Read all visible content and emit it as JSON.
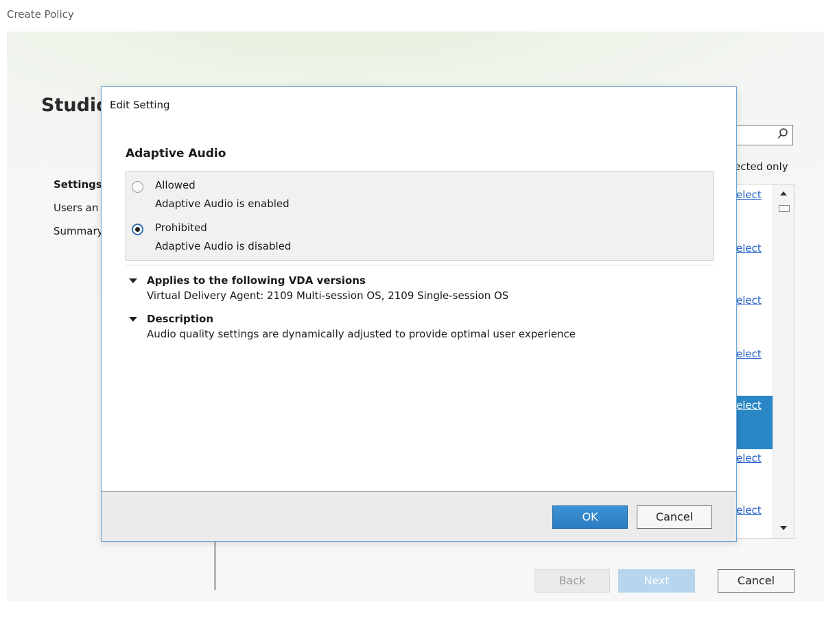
{
  "window": {
    "title": "Create Policy"
  },
  "wizard": {
    "brand": "Studio",
    "steps": [
      {
        "label": "Settings",
        "active": true
      },
      {
        "label": "Users an",
        "active": false
      },
      {
        "label": "Summary",
        "active": false
      }
    ],
    "filter_label": "ected only",
    "list_links": [
      "elect",
      "elect",
      "elect",
      "elect",
      "elect",
      "elect",
      "elect"
    ],
    "selected_link": "elect",
    "buttons": {
      "back": "Back",
      "next": "Next",
      "cancel": "Cancel"
    }
  },
  "dialog": {
    "title": "Edit Setting",
    "setting_name": "Adaptive Audio",
    "options": [
      {
        "label": "Allowed",
        "description": "Adaptive Audio is enabled",
        "checked": false
      },
      {
        "label": "Prohibited",
        "description": "Adaptive Audio is disabled",
        "checked": true
      }
    ],
    "applies": {
      "title": "Applies to the following VDA versions",
      "text": "Virtual Delivery Agent: 2109 Multi-session OS, 2109 Single-session OS"
    },
    "description": {
      "title": "Description",
      "text": "Audio quality settings are dynamically adjusted to provide optimal user experience"
    },
    "buttons": {
      "ok": "OK",
      "cancel": "Cancel"
    }
  },
  "colors": {
    "accent": "#2a87c6",
    "link": "#1f5fc9",
    "dialog_border": "#6aa4d6"
  }
}
